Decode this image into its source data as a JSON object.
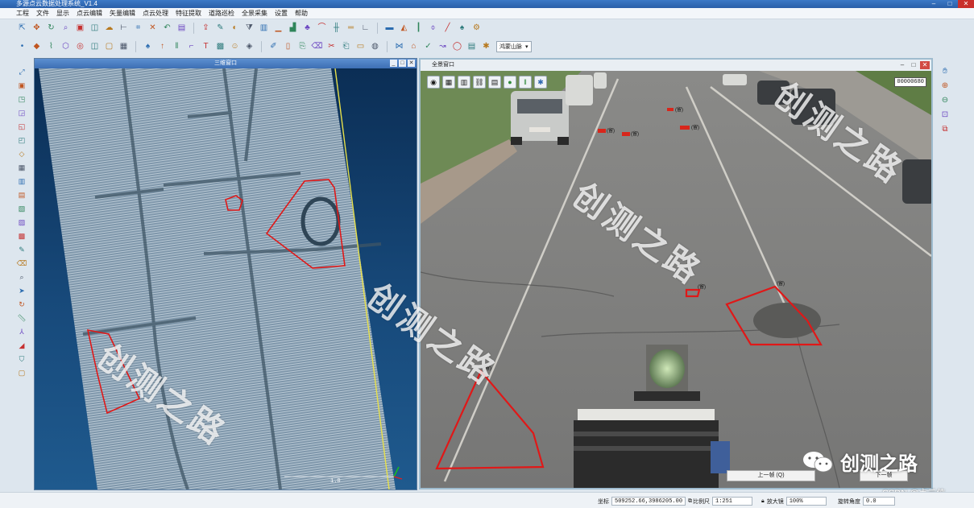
{
  "app": {
    "title": "多源点云数据处理系统_V1.4"
  },
  "menu": [
    "工程",
    "文件",
    "显示",
    "点云编辑",
    "矢量编辑",
    "点云处理",
    "特征提取",
    "道路巡检",
    "全景采集",
    "设置",
    "帮助"
  ],
  "toolbar1": [
    "select-icon",
    "pan-icon",
    "rotate-icon",
    "zoom-icon",
    "image-icon",
    "layer-icon",
    "cloud-icon",
    "measure-icon",
    "crop-icon",
    "delete-icon",
    "undo-icon",
    "save-icon",
    "export-icon",
    "paint-icon",
    "color-icon",
    "filter-icon",
    "classify-icon",
    "ground-icon",
    "building-icon",
    "vegetation-icon",
    "profile-icon",
    "section-icon",
    "road-icon",
    "curb-icon",
    "marking-icon",
    "sign-icon",
    "pole-icon",
    "lamp-icon",
    "line-icon",
    "tree-icon",
    "settings-icon"
  ],
  "toolbar2": [
    "point-icon",
    "vertex-icon",
    "polyline-icon",
    "polygon-icon",
    "capture-icon",
    "layer-icon",
    "box-icon",
    "grid-icon",
    "tree-icon",
    "arrow-icon",
    "lines-icon",
    "bracket-icon",
    "text-icon",
    "hatch-icon",
    "person-icon",
    "cube-icon",
    "pen-icon",
    "page-icon",
    "copy-icon",
    "trash-icon",
    "scissors-icon",
    "paste-icon",
    "doc-icon",
    "sphere-icon",
    "merge-icon",
    "tag-icon",
    "check-icon",
    "route-icon",
    "globe-icon",
    "card-icon",
    "gear-icon"
  ],
  "toolbar2_select": "鸿蒙山脉",
  "leftTools": [
    "zoom-extent-icon",
    "view-top-icon",
    "view-front-icon",
    "view-back-icon",
    "view-left-icon",
    "view-right-icon",
    "view-iso-icon",
    "color-rgb-icon",
    "color-intensity-icon",
    "color-height-icon",
    "color-class-icon",
    "color-return-icon",
    "color-time-icon",
    "edit-icon",
    "eraser-icon",
    "magnifier-icon",
    "pointer-icon",
    "refresh-icon",
    "ruler-icon",
    "axis-icon",
    "navigate-icon",
    "shield-icon",
    "box-icon"
  ],
  "rightTools": [
    "hand-icon",
    "zoom-in-icon",
    "zoom-out-icon",
    "fit-icon",
    "layers-icon"
  ],
  "leftPanel": {
    "title": "三维窗口",
    "scale_value": "1.0"
  },
  "rightPanel": {
    "title": "全景窗口",
    "frame_number": "00000680",
    "prev_label": "上一帧 (Q)",
    "next_label": "下一帧"
  },
  "labels": {
    "marker": "(留)"
  },
  "watermark": "创测之路",
  "brand": {
    "text": "创测之路",
    "credit": "CSDN @点云侠"
  },
  "status": {
    "coord_label": "坐标",
    "coord_value": "509252.66,3986205.00",
    "scale_label": "比例尺",
    "scale_value": "1:251",
    "zoom_label": "放大镜",
    "zoom_value": "100%",
    "rotate_label": "旋转角度",
    "rotate_value": "0.0"
  },
  "colors": {
    "accent": "#2a5fa8",
    "marker": "#e01818",
    "trajectory": "#e7e04a"
  }
}
